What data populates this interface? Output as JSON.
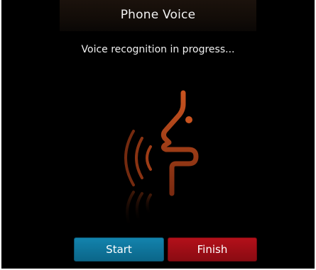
{
  "screen": {
    "title": "Phone Voice",
    "status_text": "Voice recognition in progress..."
  },
  "graphic": {
    "icon": "voice-recognition-icon",
    "color": "#b24a1e"
  },
  "buttons": {
    "start_label": "Start",
    "finish_label": "Finish"
  },
  "colors": {
    "background": "#000000",
    "start": "#0f7aa2",
    "finish": "#a00e17"
  }
}
